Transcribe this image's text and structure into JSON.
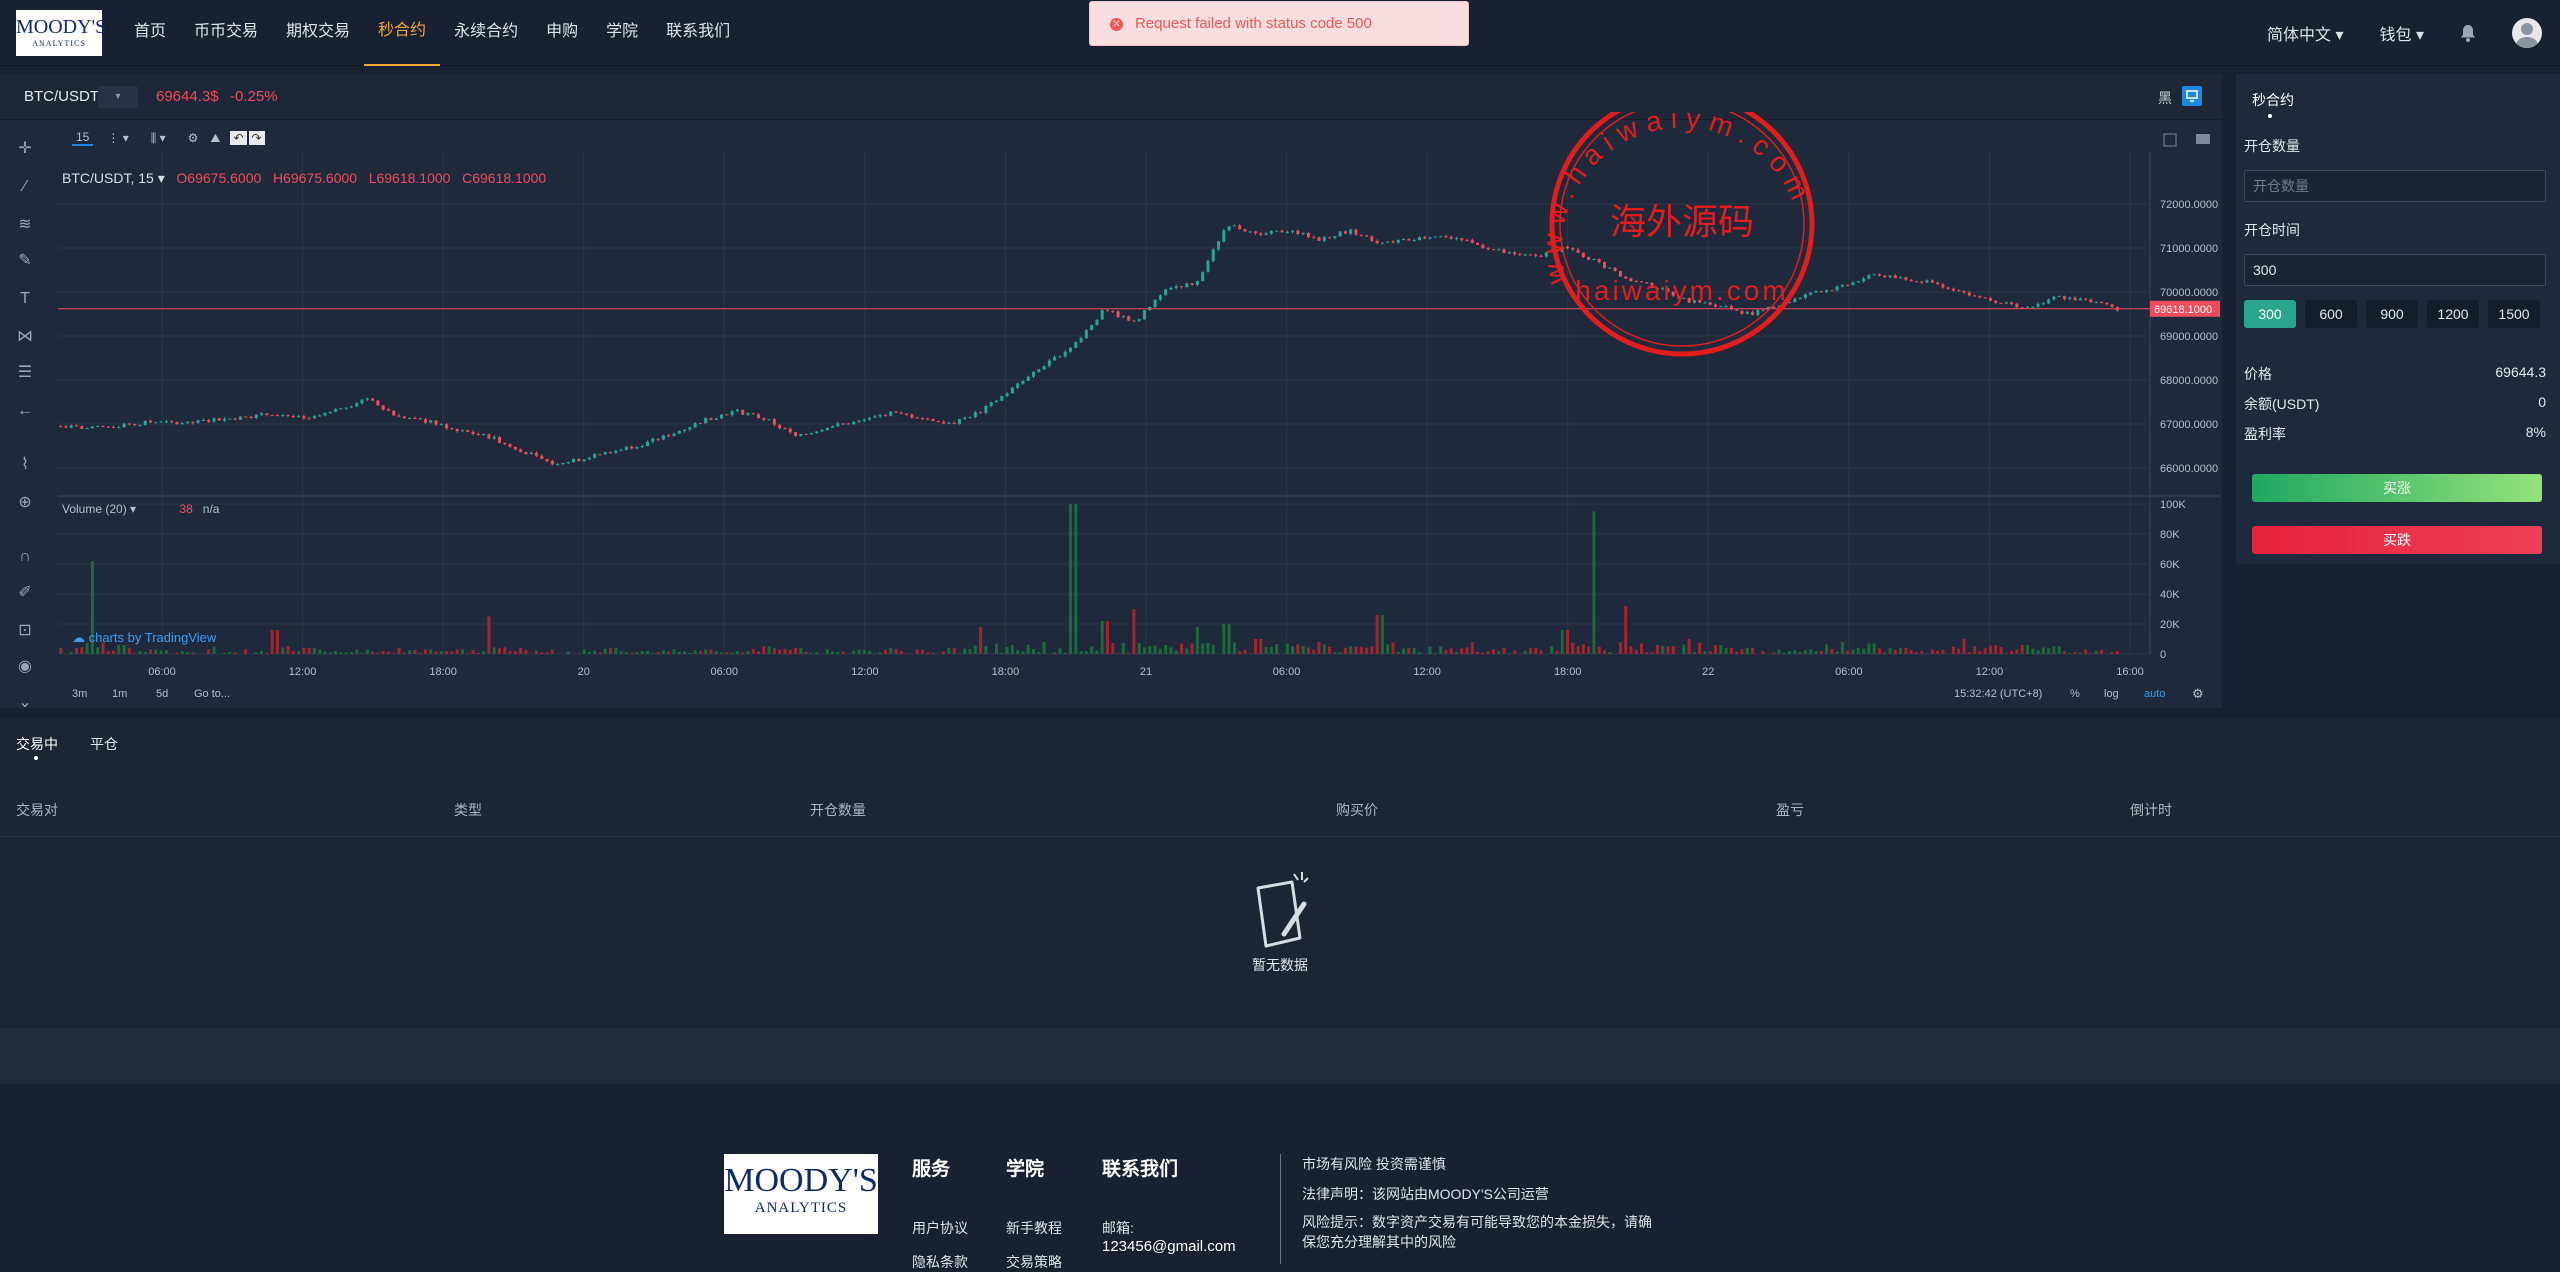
{
  "header": {
    "logo_top": "MOODY'S",
    "logo_bottom": "ANALYTICS",
    "nav": [
      "首页",
      "币币交易",
      "期权交易",
      "秒合约",
      "永续合约",
      "申购",
      "学院",
      "联系我们"
    ],
    "active_nav": "秒合约",
    "language": "简体中文",
    "wallet": "钱包"
  },
  "toast": {
    "message": "Request failed with status code 500"
  },
  "ticker": {
    "symbol": "BTC/USDT",
    "price": "69644.3$",
    "change": "-0.25%",
    "theme_label": "黑"
  },
  "chart_toolbar": {
    "interval": "15"
  },
  "chart_legend": {
    "symbol": "BTC/USDT, 15",
    "open": "O69675.6000",
    "high": "H69675.6000",
    "low": "L69618.1000",
    "close": "C69618.1000",
    "volume_label": "Volume (20)",
    "volume_value": "38",
    "volume_na": "n/a",
    "powered_by": "charts by TradingView"
  },
  "chart_data": {
    "type": "candlestick",
    "price_axis": [
      "72000.0000",
      "71000.0000",
      "70000.0000",
      "69000.0000",
      "68000.0000",
      "67000.0000",
      "66000.0000"
    ],
    "volume_axis": [
      "100K",
      "80K",
      "60K",
      "40K",
      "20K",
      "0"
    ],
    "current_price_label": "69618.1000",
    "ylim": [
      65500,
      72500
    ],
    "time_axis": [
      "06:00",
      "12:00",
      "18:00",
      "20",
      "06:00",
      "12:00",
      "18:00",
      "21",
      "06:00",
      "12:00",
      "18:00",
      "22",
      "06:00",
      "12:00",
      "16:00"
    ],
    "price_path": [
      66950,
      66900,
      66970,
      67050,
      67000,
      67100,
      67150,
      67250,
      67100,
      67300,
      67600,
      67150,
      67050,
      66850,
      66700,
      66400,
      66100,
      66200,
      66400,
      66550,
      66800,
      67100,
      67300,
      67100,
      66700,
      66950,
      67050,
      67250,
      67150,
      67000,
      67300,
      67800,
      68300,
      68800,
      69600,
      69300,
      70100,
      70200,
      71550,
      71300,
      71400,
      71200,
      71400,
      71100,
      71200,
      71300,
      71100,
      70900,
      70800,
      71000,
      70700,
      70300,
      70100,
      69800,
      69700,
      69500,
      69700,
      70000,
      70100,
      70400,
      70300,
      70200,
      70000,
      69800,
      69600,
      69900,
      69800,
      69620
    ],
    "volume_path": [
      4,
      62,
      6,
      3,
      2,
      5,
      3,
      16,
      4,
      2,
      3,
      4,
      3,
      3,
      25,
      4,
      3,
      3,
      4,
      2,
      3,
      3,
      2,
      5,
      4,
      3,
      3,
      4,
      3,
      4,
      18,
      6,
      8,
      100,
      22,
      30,
      6,
      18,
      20,
      10,
      7,
      8,
      5,
      26,
      4,
      5,
      8,
      4,
      4,
      16,
      95,
      32,
      6,
      10,
      6,
      4,
      3,
      3,
      8,
      7,
      4,
      3,
      10,
      6,
      6,
      5,
      3,
      2
    ],
    "volume_ylim": [
      0,
      100
    ]
  },
  "chart_bottom": {
    "ranges": [
      "3m",
      "1m",
      "5d"
    ],
    "goto": "Go to...",
    "clock": "15:32:42 (UTC+8)",
    "pct": "%",
    "log": "log",
    "auto": "auto"
  },
  "trade_panel": {
    "tab": "秒合约",
    "qty_label": "开仓数量",
    "qty_placeholder": "开仓数量",
    "time_label": "开仓时间",
    "time_value": "300",
    "durations": [
      "300",
      "600",
      "900",
      "1200",
      "1500"
    ],
    "price_label": "价格",
    "price_value": "69644.3",
    "balance_label": "余额(USDT)",
    "balance_value": "0",
    "profit_label": "盈利率",
    "profit_value": "8%",
    "buy_up": "买涨",
    "buy_down": "买跌"
  },
  "orders": {
    "tabs": [
      "交易中",
      "平仓"
    ],
    "columns": [
      "交易对",
      "类型",
      "开仓数量",
      "购买价",
      "盈亏",
      "倒计时"
    ],
    "empty_text": "暂无数据"
  },
  "stamp": {
    "ring_text": "www.haiwaiym.com",
    "center_text": "海外源码",
    "url_text": "haiwaiym.com",
    "colors": {
      "stamp": "#e31c1c"
    }
  },
  "footer": {
    "logo_top": "MOODY'S",
    "logo_bottom": "ANALYTICS",
    "services_title": "服务",
    "academy_title": "学院",
    "contact_title": "联系我们",
    "services_items": [
      "用户协议",
      "隐私条款"
    ],
    "academy_items": [
      "新手教程",
      "交易策略"
    ],
    "email_label": "邮箱:",
    "email": "123456@gmail.com",
    "notice1": "市场有风险 投资需谨慎",
    "notice2": "法律声明：该网站由MOODY'S公司运营",
    "notice3": "风险提示：数字资产交易有可能导致您的本金损失，请确保您充分理解其中的风险"
  }
}
